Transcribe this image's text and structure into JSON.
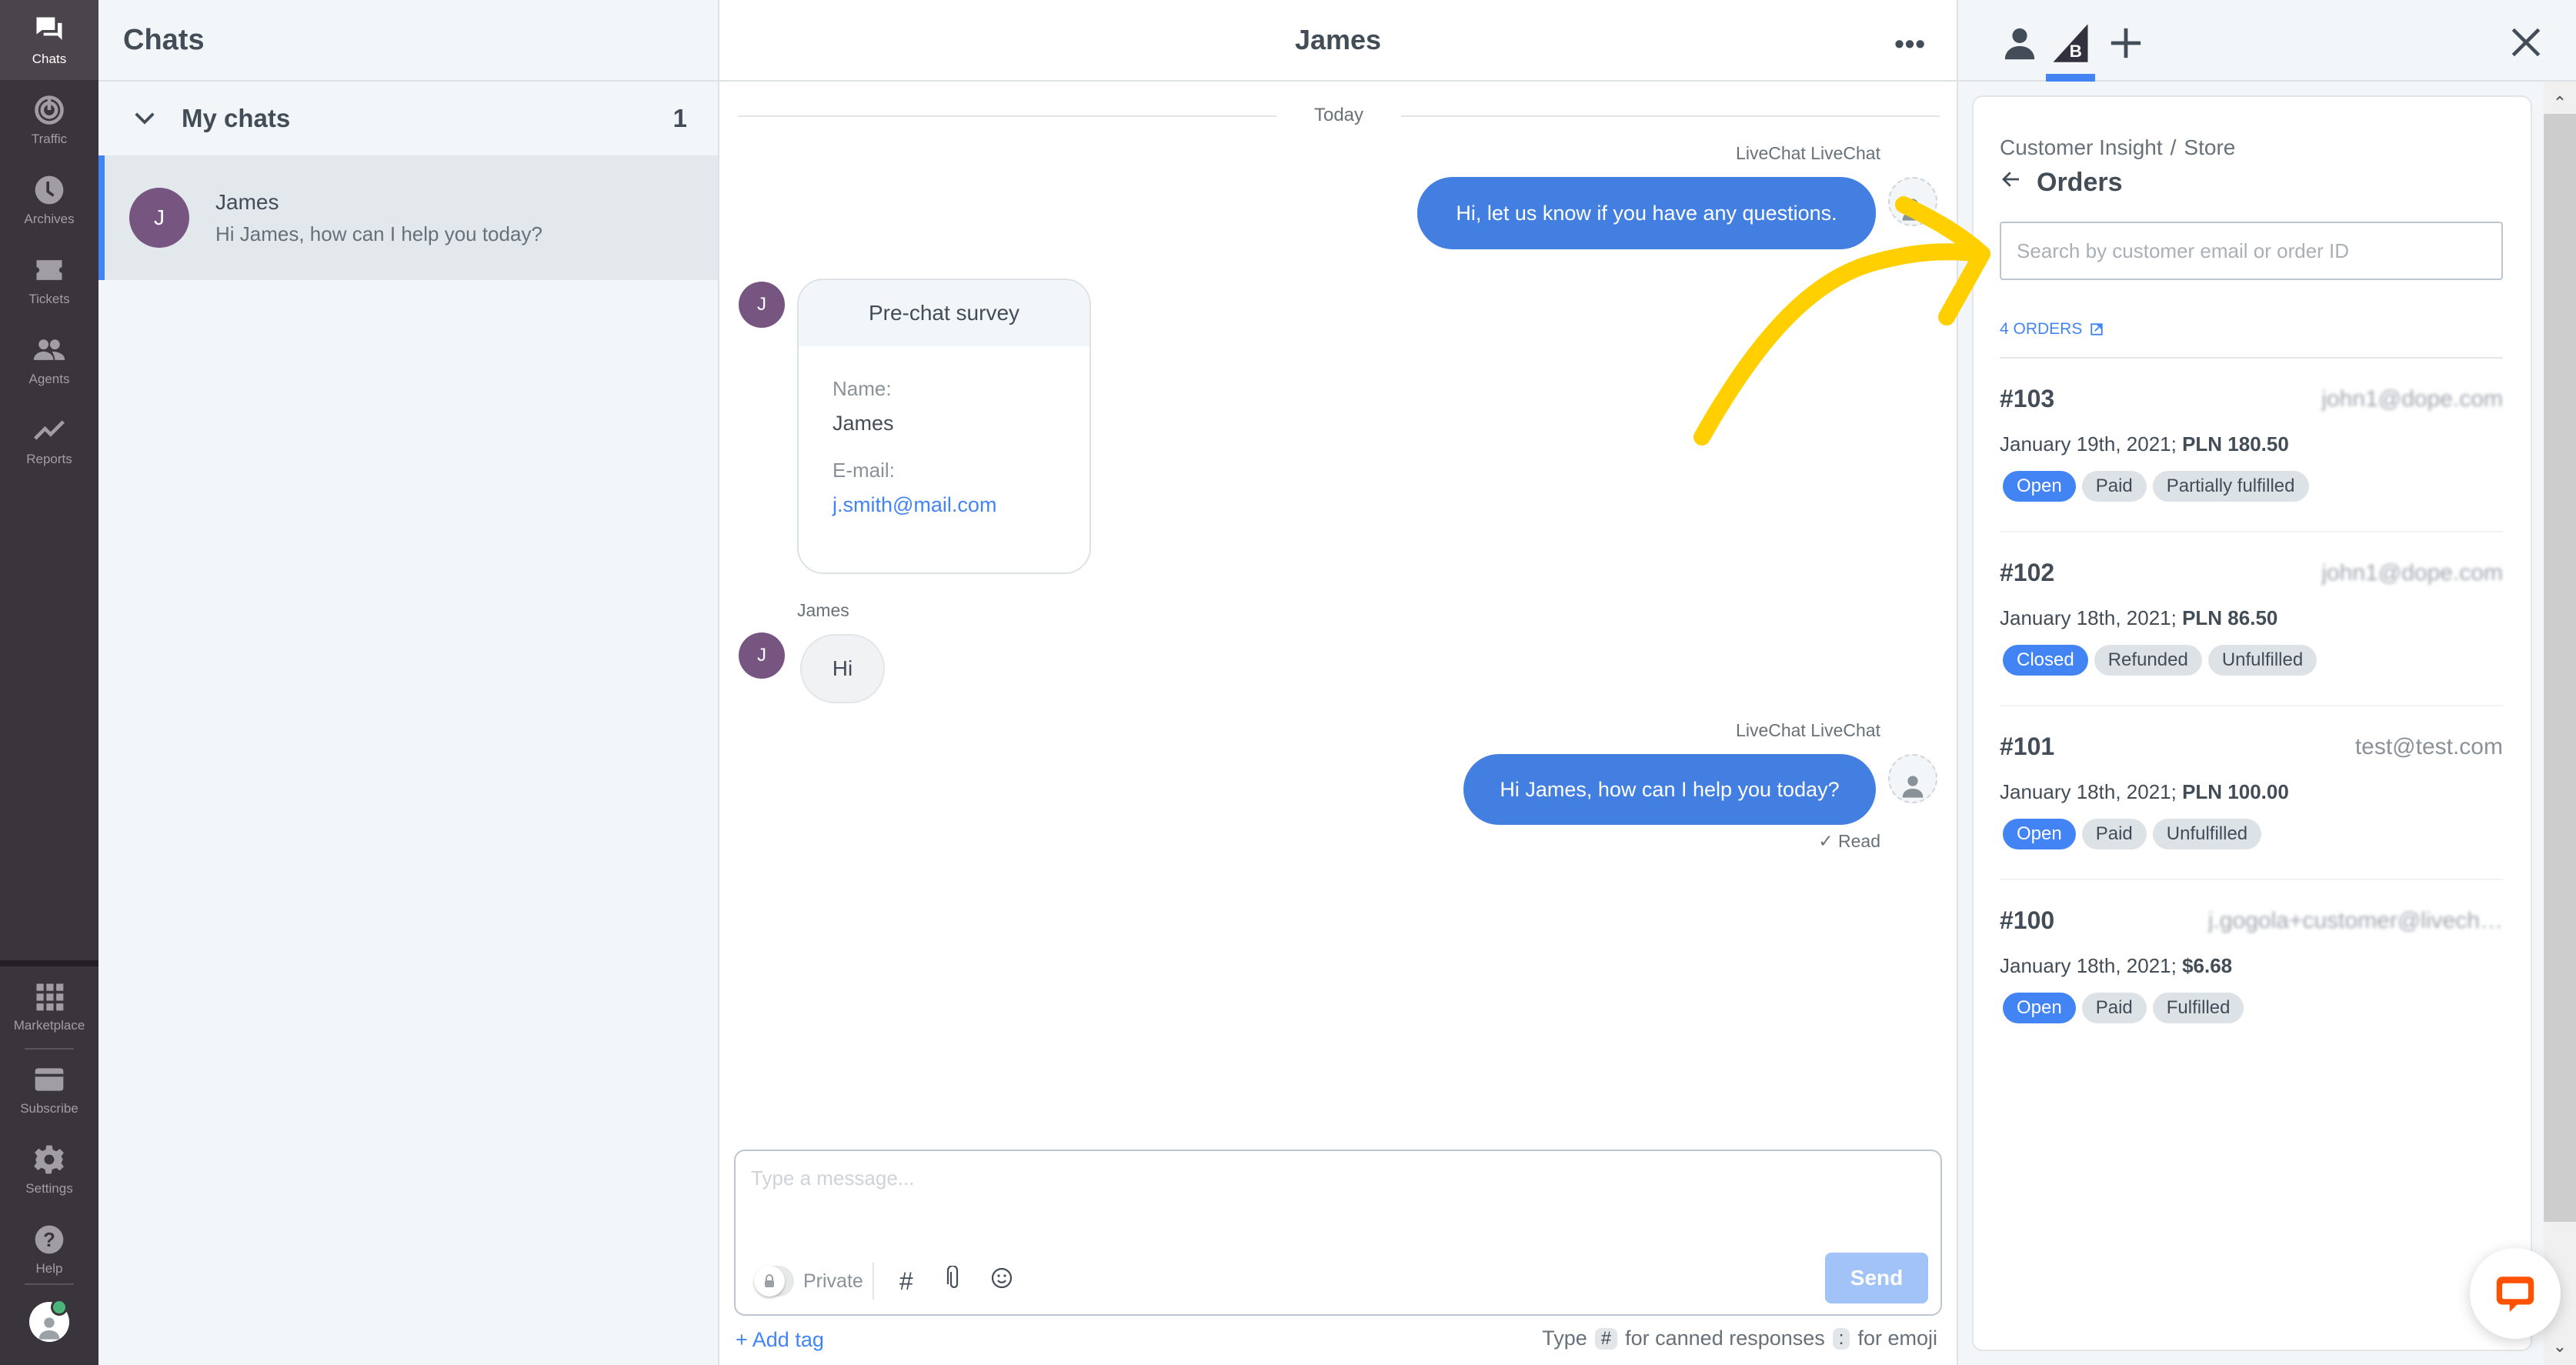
{
  "nav": {
    "top_items": [
      {
        "id": "chats",
        "label": "Chats",
        "icon": "chat-bubbles-icon",
        "active": true
      },
      {
        "id": "traffic",
        "label": "Traffic",
        "icon": "radar-icon",
        "active": false
      },
      {
        "id": "archives",
        "label": "Archives",
        "icon": "clock-icon",
        "active": false
      },
      {
        "id": "tickets",
        "label": "Tickets",
        "icon": "ticket-icon",
        "active": false
      },
      {
        "id": "agents",
        "label": "Agents",
        "icon": "people-icon",
        "active": false
      },
      {
        "id": "reports",
        "label": "Reports",
        "icon": "trend-line-icon",
        "active": false
      }
    ],
    "bottom_items": [
      {
        "id": "marketplace",
        "label": "Marketplace",
        "icon": "grid-icon"
      },
      {
        "id": "subscribe",
        "label": "Subscribe",
        "icon": "credit-card-icon"
      },
      {
        "id": "settings",
        "label": "Settings",
        "icon": "gear-icon"
      },
      {
        "id": "help",
        "label": "Help",
        "icon": "question-icon"
      }
    ],
    "user_status": "online"
  },
  "chat_list": {
    "title": "Chats",
    "group": {
      "label": "My chats",
      "count": "1"
    },
    "items": [
      {
        "initial": "J",
        "name": "James",
        "preview": "Hi James, how can I help you today?",
        "selected": true
      }
    ]
  },
  "chat": {
    "title": "James",
    "more_label": "•••",
    "day_separator": "Today",
    "messages": [
      {
        "type": "agent",
        "sender": "LiveChat LiveChat",
        "text": "Hi, let us know if you have any questions."
      },
      {
        "type": "survey",
        "initial": "J",
        "title": "Pre-chat survey",
        "fields": [
          {
            "key": "Name:",
            "value": "James",
            "link": false
          },
          {
            "key": "E-mail:",
            "value": "j.smith@mail.com",
            "link": true
          }
        ]
      },
      {
        "type": "customer",
        "sender": "James",
        "initial": "J",
        "text": "Hi"
      },
      {
        "type": "agent",
        "sender": "LiveChat LiveChat",
        "text": "Hi James, how can I help you today?",
        "status": "Read"
      }
    ],
    "composer": {
      "placeholder": "Type a message...",
      "value": "",
      "private_label": "Private",
      "send_label": "Send",
      "add_tag_label": "+ Add tag",
      "hint": {
        "type": "Type",
        "canned_key": "#",
        "canned_text": "for canned responses",
        "emoji_key": ":",
        "emoji_text": "for emoji"
      }
    }
  },
  "right_panel": {
    "tabs": [
      {
        "id": "customer",
        "icon": "person-icon",
        "active": false
      },
      {
        "id": "bigcommerce",
        "icon": "bigcommerce-logo-icon",
        "active": true
      },
      {
        "id": "add",
        "icon": "plus-icon",
        "active": false
      }
    ],
    "breadcrumb": [
      "Customer Insight",
      "Store"
    ],
    "breadcrumb_sep": "/",
    "title": "Orders",
    "search_placeholder": "Search by customer email or order ID",
    "search_value": "",
    "orders_count_label": "4 ORDERS",
    "orders": [
      {
        "id": "#103",
        "email": "john1@dope.com",
        "email_blurred": true,
        "date": "January 19th, 2021;",
        "amount": "PLN 180.50",
        "badges": [
          {
            "label": "Open",
            "primary": true
          },
          {
            "label": "Paid",
            "primary": false
          },
          {
            "label": "Partially fulfilled",
            "primary": false
          }
        ]
      },
      {
        "id": "#102",
        "email": "john1@dope.com",
        "email_blurred": true,
        "date": "January 18th, 2021;",
        "amount": "PLN 86.50",
        "badges": [
          {
            "label": "Closed",
            "primary": true
          },
          {
            "label": "Refunded",
            "primary": false
          },
          {
            "label": "Unfulfilled",
            "primary": false
          }
        ]
      },
      {
        "id": "#101",
        "email": "test@test.com",
        "email_blurred": false,
        "date": "January 18th, 2021;",
        "amount": "PLN 100.00",
        "badges": [
          {
            "label": "Open",
            "primary": true
          },
          {
            "label": "Paid",
            "primary": false
          },
          {
            "label": "Unfulfilled",
            "primary": false
          }
        ]
      },
      {
        "id": "#100",
        "email": "j.gogola+customer@livech…",
        "email_blurred": true,
        "date": "January 18th, 2021;",
        "amount": "$6.68",
        "badges": [
          {
            "label": "Open",
            "primary": true
          },
          {
            "label": "Paid",
            "primary": false
          },
          {
            "label": "Fulfilled",
            "primary": false
          }
        ]
      }
    ]
  },
  "colors": {
    "accent": "#4384f5",
    "agent_bubble": "#427fe1",
    "nav_bg": "#3a353d",
    "customer_avatar": "#775581",
    "annotation_arrow": "#ffcf00",
    "livechat_orange": "#ff5100"
  }
}
